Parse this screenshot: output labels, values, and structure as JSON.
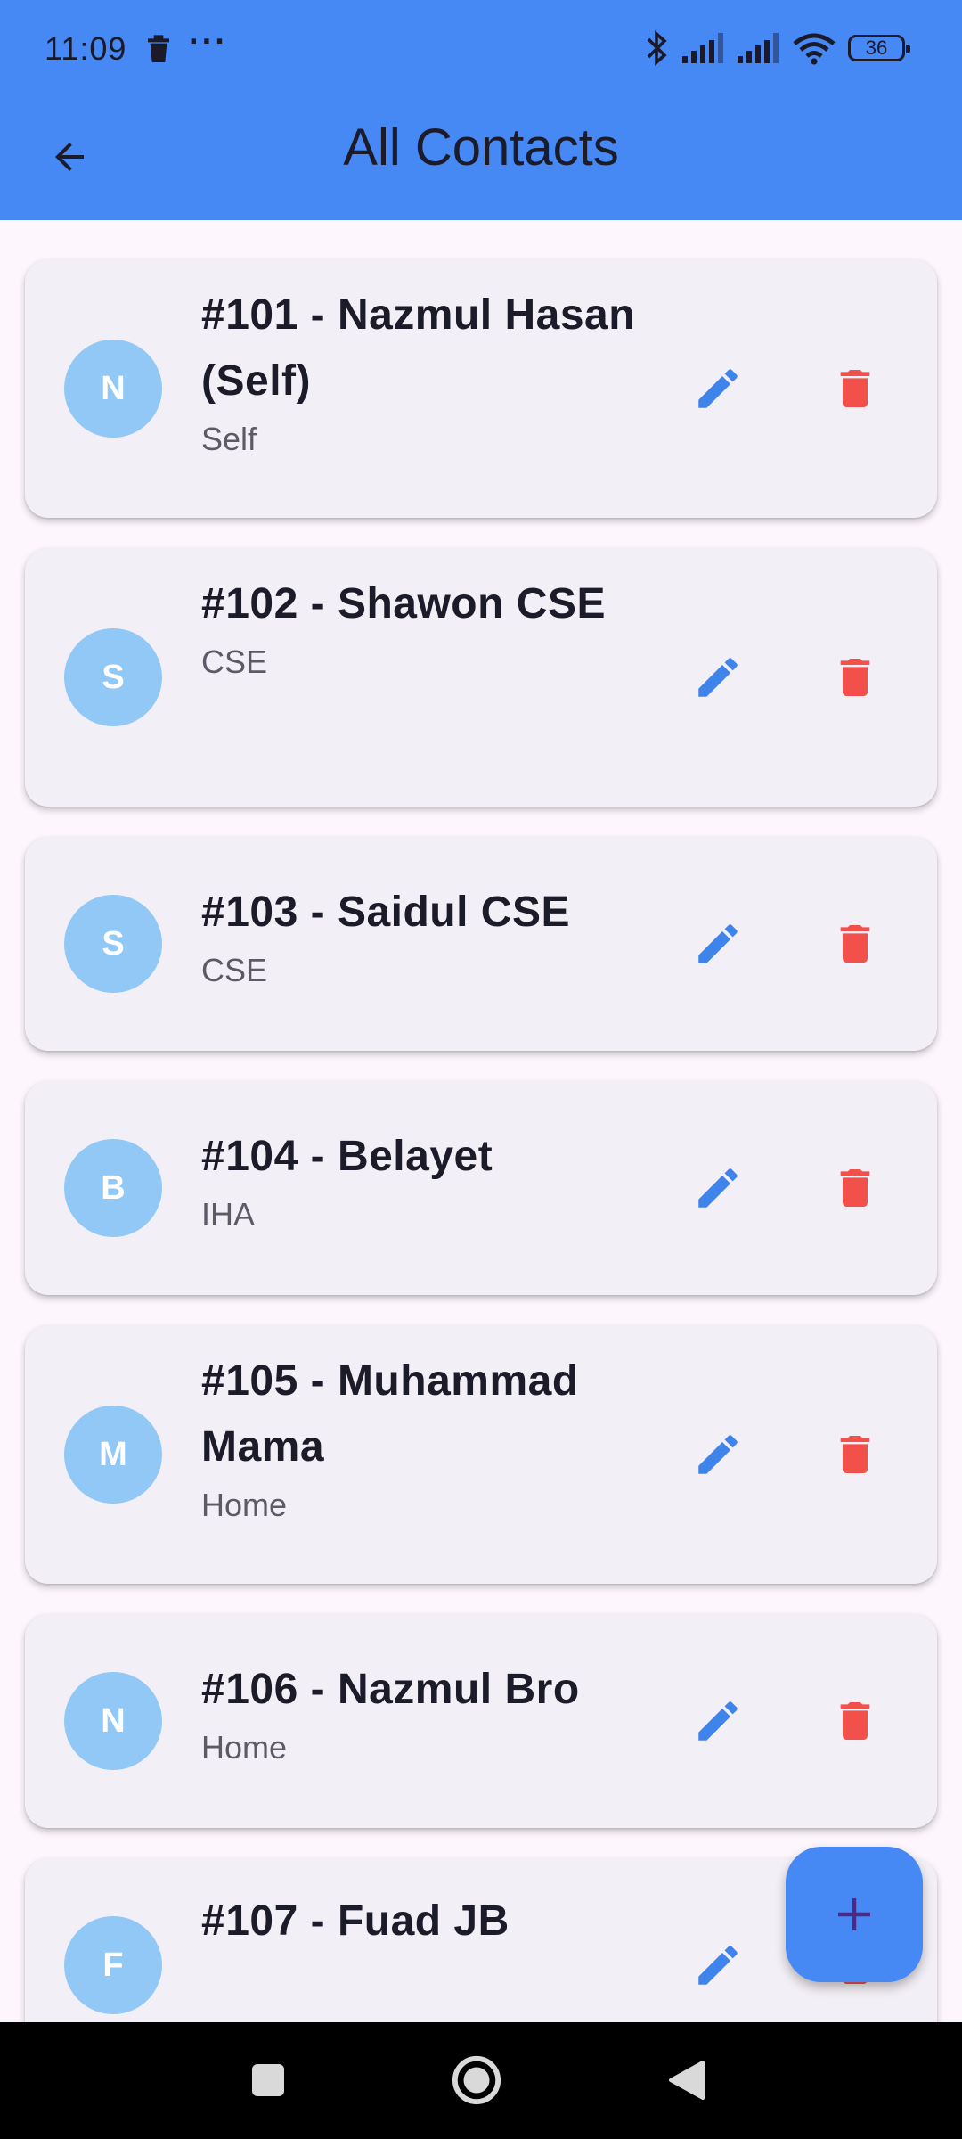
{
  "status_bar": {
    "time": "11:09",
    "overflow": "···",
    "battery": "36",
    "icons": [
      "trash-icon",
      "bluetooth-icon",
      "signal-icon",
      "signal-icon",
      "wifi-icon",
      "battery-icon"
    ]
  },
  "app_bar": {
    "title": "All Contacts",
    "back_icon": "arrow-back-icon"
  },
  "colors": {
    "primary": "#4688f4",
    "avatar": "#91c8f6",
    "edit": "#3f84ea",
    "delete": "#f2504b",
    "card": "#f3eff6"
  },
  "contacts": [
    {
      "initial": "N",
      "name": "#101 - Nazmul Hasan (Self)",
      "group": "Self"
    },
    {
      "initial": "S",
      "name": "#102 - Shawon CSE",
      "group": "CSE"
    },
    {
      "initial": "S",
      "name": "#103 - Saidul CSE",
      "group": "CSE"
    },
    {
      "initial": "B",
      "name": "#104 - Belayet",
      "group": "IHA"
    },
    {
      "initial": "M",
      "name": "#105 - Muhammad Mama",
      "group": "Home"
    },
    {
      "initial": "N",
      "name": "#106 - Nazmul Bro",
      "group": "Home"
    },
    {
      "initial": "F",
      "name": "#107 - Fuad JB",
      "group": ""
    }
  ],
  "fab": {
    "icon": "plus-icon",
    "label": "+"
  },
  "nav_bar": {
    "icons": [
      "recents-square-icon",
      "home-circle-icon",
      "back-triangle-icon"
    ]
  }
}
